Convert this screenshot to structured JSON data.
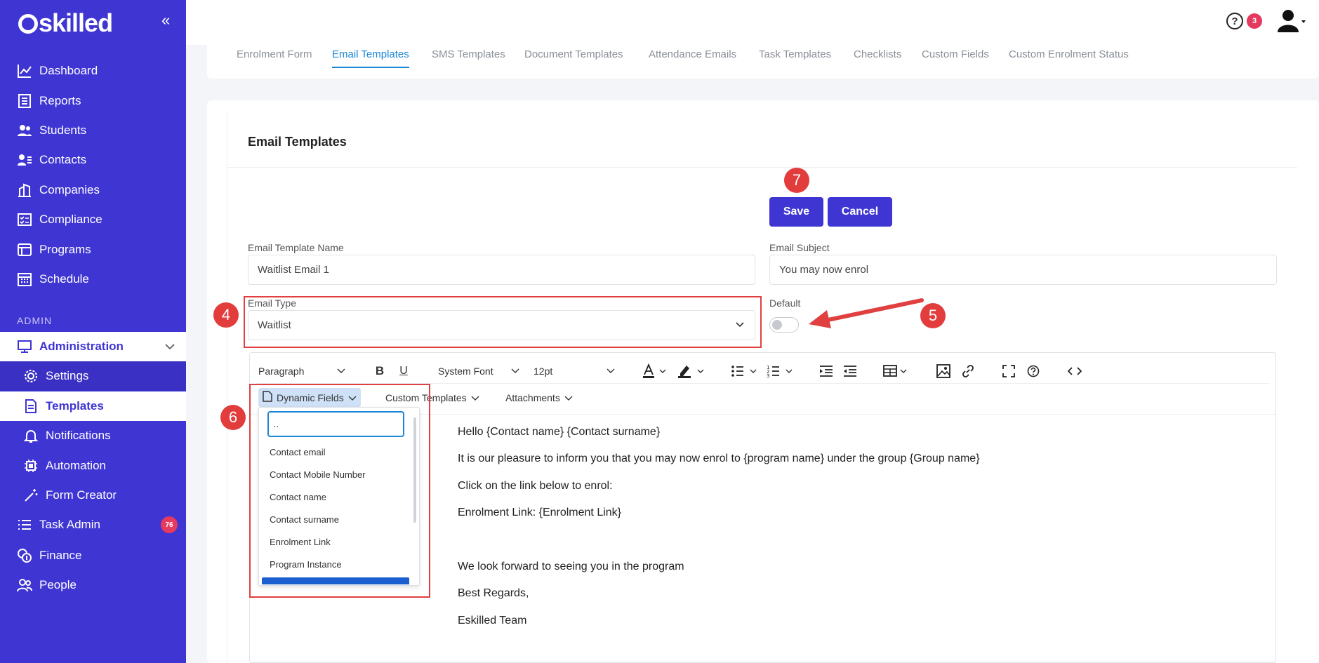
{
  "brand": {
    "logo_text": "skilled"
  },
  "sidebar": {
    "items": [
      {
        "label": "Dashboard"
      },
      {
        "label": "Reports"
      },
      {
        "label": "Students"
      },
      {
        "label": "Contacts"
      },
      {
        "label": "Companies"
      },
      {
        "label": "Compliance"
      },
      {
        "label": "Programs"
      },
      {
        "label": "Schedule"
      }
    ],
    "section_label": "ADMIN",
    "admin": {
      "label": "Administration"
    },
    "admin_sub": [
      {
        "label": "Settings"
      },
      {
        "label": "Templates"
      },
      {
        "label": "Notifications"
      },
      {
        "label": "Automation"
      },
      {
        "label": "Form Creator"
      }
    ],
    "bottom": [
      {
        "label": "Task Admin",
        "badge": "76"
      },
      {
        "label": "Finance"
      },
      {
        "label": "People"
      }
    ]
  },
  "topbar": {
    "help_icon": "?",
    "notification_count": "3"
  },
  "tabs": [
    {
      "label": "Enrolment Form"
    },
    {
      "label": "Email Templates"
    },
    {
      "label": "SMS Templates"
    },
    {
      "label": "Document Templates"
    },
    {
      "label": "Attendance Emails"
    },
    {
      "label": "Task Templates"
    },
    {
      "label": "Checklists"
    },
    {
      "label": "Custom Fields"
    },
    {
      "label": "Custom Enrolment Status"
    }
  ],
  "page": {
    "title": "Email Templates",
    "save_label": "Save",
    "cancel_label": "Cancel"
  },
  "form": {
    "name_label": "Email Template Name",
    "name_value": "Waitlist Email 1",
    "subject_label": "Email Subject",
    "subject_value": "You may now enrol",
    "type_label": "Email Type",
    "type_value": "Waitlist",
    "default_label": "Default",
    "default_on": false
  },
  "editor": {
    "block_format": "Paragraph",
    "font_family": "System Font",
    "font_size": "12pt",
    "menus": {
      "dynamic_fields": "Dynamic Fields",
      "custom_templates": "Custom Templates",
      "attachments": "Attachments"
    },
    "content": [
      "Hello {Contact name} {Contact surname}",
      "It is our pleasure to inform you that you may now enrol to {program name} under the group {Group name}",
      "Click on the link below to enrol:",
      "Enrolment Link: {Enrolment Link}",
      "We look forward to seeing you in the program",
      "Best Regards,",
      "Eskilled Team"
    ]
  },
  "dropdown": {
    "search_value": "..",
    "items": [
      "Contact email",
      "Contact Mobile Number",
      "Contact name",
      "Contact surname",
      "Enrolment Link",
      "Program Instance"
    ]
  },
  "annotations": [
    "4",
    "5",
    "6",
    "7"
  ],
  "colors": {
    "sidebar": "#3f35d3",
    "accent": "#1c86d6",
    "badge": "#e6395f",
    "annotation": "#e04040"
  }
}
